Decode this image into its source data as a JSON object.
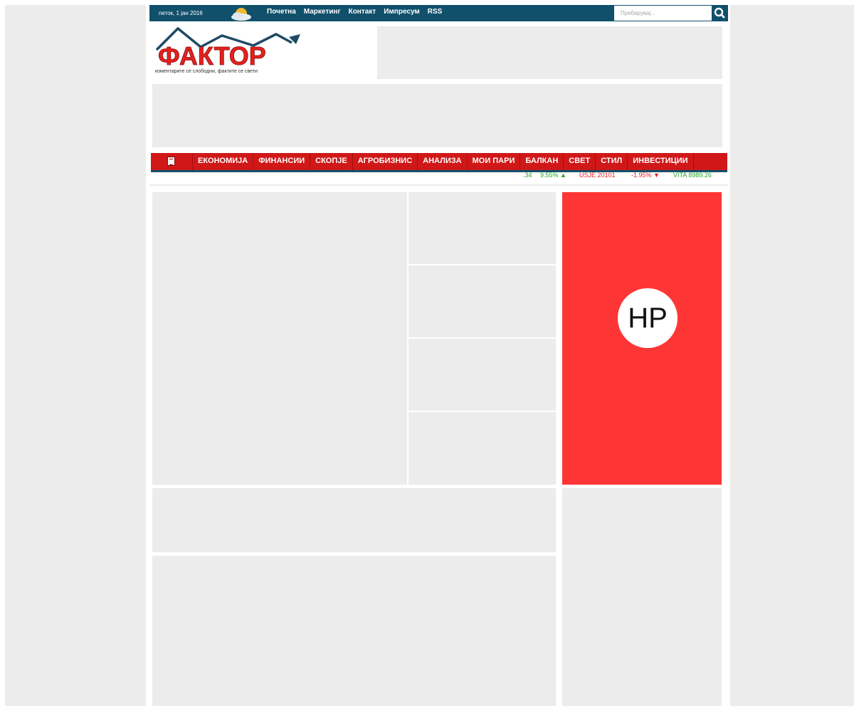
{
  "topbar": {
    "date": "петок, 1 јан 2016",
    "links": [
      "Почетна",
      "Маркетинг",
      "Контакт",
      "Импресум",
      "RSS"
    ],
    "search_placeholder": "Пребарувај...",
    "weather_icon": "partly-cloudy-icon",
    "search_icon": "search-icon"
  },
  "header": {
    "logo_text": "ФАКТОР",
    "tagline": "коментарите се слободни, фактите се свети"
  },
  "nav": {
    "home_icon": "newspaper-icon",
    "items": [
      "ЕКОНОМИЈА",
      "ФИНАНСИИ",
      "СКОПЈЕ",
      "АГРОБИЗНИС",
      "АНАЛИЗА",
      "МОИ ПАРИ",
      "БАЛКАН",
      "СВЕТ",
      "СТИЛ",
      "ИНВЕСТИЦИИ"
    ]
  },
  "ticker": [
    {
      "text": ".34",
      "dir": "up"
    },
    {
      "text": "9.55%",
      "dir": "up"
    },
    {
      "text": "USJE 20101",
      "dir": "down"
    },
    {
      "text": "-1.95%",
      "dir": "down"
    },
    {
      "text": "VITA 8989.26",
      "dir": "up"
    }
  ],
  "ad": {
    "brand": "HP"
  },
  "colors": {
    "topbar": "#11506b",
    "nav": "#d01818",
    "ad": "#fe3535",
    "placeholder": "#ececec"
  }
}
